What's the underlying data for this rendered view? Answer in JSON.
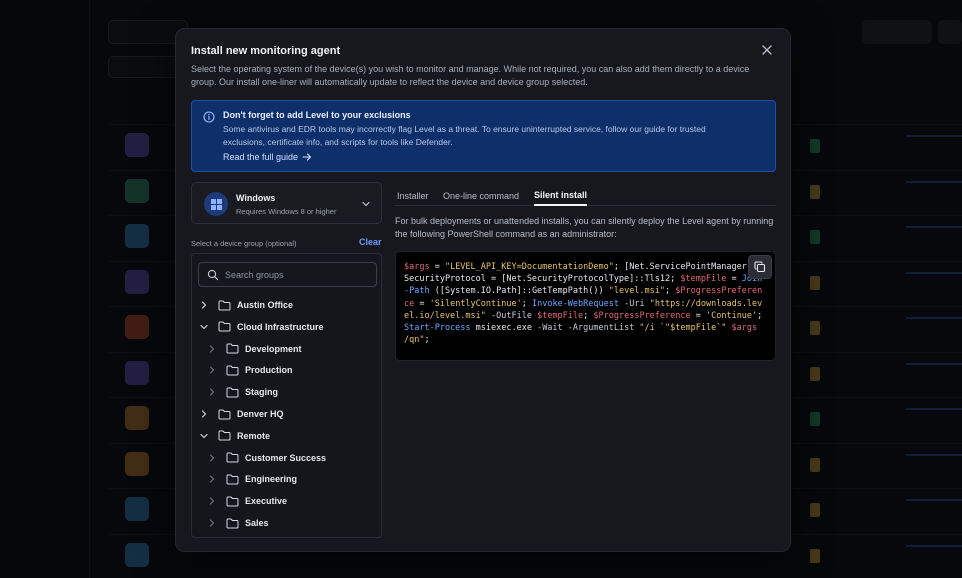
{
  "modal": {
    "title": "Install new monitoring agent",
    "description": "Select the operating system of the device(s) you wish to monitor and manage. While not required, you can also add them directly to a device group. Our install one-liner will automatically update to reflect the device and device group selected.",
    "close_icon": "close-icon"
  },
  "alert": {
    "title": "Don't forget to add Level to your exclusions",
    "body": "Some antivirus and EDR tools may incorrectly flag Level as a threat. To ensure uninterrupted service, follow our guide for trusted exclusions, certificate info, and scripts for tools like Defender.",
    "link": "Read the full guide",
    "icon": "info-icon"
  },
  "os": {
    "name": "Windows",
    "requirement": "Requires Windows 8 or higher",
    "icon": "windows-icon"
  },
  "device_group": {
    "label": "Select a device group (optional)",
    "clear": "Clear",
    "search_placeholder": "Search groups",
    "items": [
      {
        "label": "Austin Office",
        "level": 0,
        "expanded": false
      },
      {
        "label": "Cloud Infrastructure",
        "level": 0,
        "expanded": true
      },
      {
        "label": "Development",
        "level": 1,
        "expanded": false
      },
      {
        "label": "Production",
        "level": 1,
        "expanded": false
      },
      {
        "label": "Staging",
        "level": 1,
        "expanded": false
      },
      {
        "label": "Denver HQ",
        "level": 0,
        "expanded": false
      },
      {
        "label": "Remote",
        "level": 0,
        "expanded": true
      },
      {
        "label": "Customer Success",
        "level": 1,
        "expanded": false
      },
      {
        "label": "Engineering",
        "level": 1,
        "expanded": false
      },
      {
        "label": "Executive",
        "level": 1,
        "expanded": false
      },
      {
        "label": "Sales",
        "level": 1,
        "expanded": false
      }
    ]
  },
  "tabs": {
    "installer": "Installer",
    "one_line": "One-line command",
    "silent": "Silent install",
    "active": "silent"
  },
  "silent_install": {
    "description": "For bulk deployments or unattended installs, you can silently deploy the Level agent by running the following PowerShell command as an administrator:",
    "code_tokens": [
      {
        "t": "var",
        "v": "$args"
      },
      {
        "t": "plain",
        "v": " = "
      },
      {
        "t": "str",
        "v": "\"LEVEL_API_KEY=DocumentationDemo\""
      },
      {
        "t": "plain",
        "v": "; [Net.ServicePointManager]::SecurityProtocol = [Net.SecurityProtocolType]::Tls12; "
      },
      {
        "t": "var",
        "v": "$tempFile"
      },
      {
        "t": "plain",
        "v": " = "
      },
      {
        "t": "cmd",
        "v": "Join-Path"
      },
      {
        "t": "plain",
        "v": " ([System.IO.Path]::GetTempPath()) "
      },
      {
        "t": "str",
        "v": "\"level.msi\""
      },
      {
        "t": "plain",
        "v": "; "
      },
      {
        "t": "var",
        "v": "$ProgressPreference"
      },
      {
        "t": "plain",
        "v": " = "
      },
      {
        "t": "str",
        "v": "'SilentlyContinue'"
      },
      {
        "t": "plain",
        "v": "; "
      },
      {
        "t": "cmd",
        "v": "Invoke-WebRequest"
      },
      {
        "t": "flag",
        "v": " -Uri "
      },
      {
        "t": "str",
        "v": "\"https://downloads.level.io/level.msi\""
      },
      {
        "t": "flag",
        "v": " -OutFile "
      },
      {
        "t": "var",
        "v": "$tempFile"
      },
      {
        "t": "plain",
        "v": "; "
      },
      {
        "t": "var",
        "v": "$ProgressPreference"
      },
      {
        "t": "plain",
        "v": " = "
      },
      {
        "t": "str",
        "v": "'Continue'"
      },
      {
        "t": "plain",
        "v": "; "
      },
      {
        "t": "cmd",
        "v": "Start-Process"
      },
      {
        "t": "plain",
        "v": " msiexec.exe"
      },
      {
        "t": "flag",
        "v": " -Wait -ArgumentList "
      },
      {
        "t": "str",
        "v": "\"/i `\"$tempFile`\" "
      },
      {
        "t": "var",
        "v": "$args"
      },
      {
        "t": "str",
        "v": " /qn\""
      },
      {
        "t": "plain",
        "v": ";"
      }
    ],
    "copy_icon": "copy-icon"
  },
  "colors": {
    "alert_bg": "#0f2f6a",
    "accent": "#6c9cff",
    "code_var": "#e0697a",
    "code_str": "#e9c46a",
    "code_cmd": "#6ea8ff"
  }
}
